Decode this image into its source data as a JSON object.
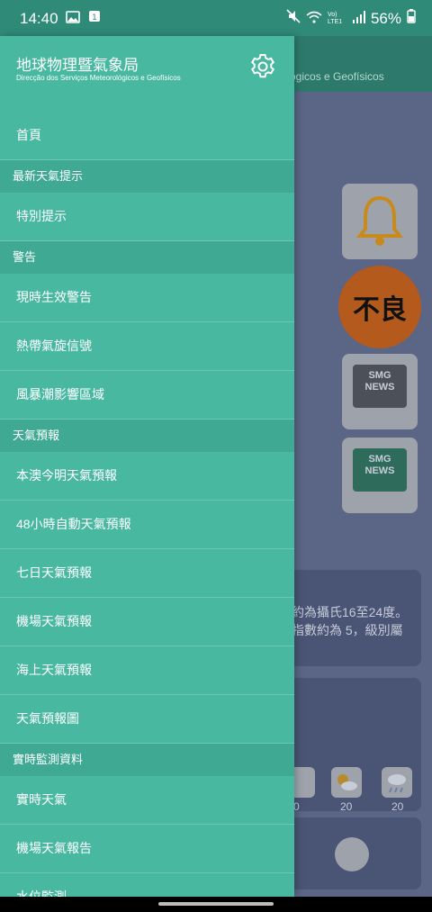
{
  "status": {
    "time": "14:40",
    "battery": "56%",
    "volte": "Vo) LTE1"
  },
  "bg": {
    "header_text": "ógicos e Geofísicos",
    "air_quality": "不良",
    "news_label": "SMG NEWS",
    "text1": "約為攝氏16至24度。",
    "text2": "指數約為 5，級別屬",
    "temps": [
      "0",
      "20",
      "20"
    ]
  },
  "drawer": {
    "title": "地球物理暨氣象局",
    "subtitle": "Direcção dos Serviços Meteorológicos e Geofísicos",
    "home": "首頁",
    "sections": [
      {
        "label": "最新天氣提示",
        "items": [
          "特別提示"
        ]
      },
      {
        "label": "警告",
        "items": [
          "現時生效警告",
          "熱帶氣旋信號",
          "風暴潮影響區域"
        ]
      },
      {
        "label": "天氣預報",
        "items": [
          "本澳今明天氣預報",
          "48小時自動天氣預報",
          "七日天氣預報",
          "機場天氣預報",
          "海上天氣預報",
          "天氣預報圖"
        ]
      },
      {
        "label": "實時監測資料",
        "items": [
          "實時天氣",
          "機場天氣報告",
          "水位監測"
        ]
      }
    ]
  }
}
